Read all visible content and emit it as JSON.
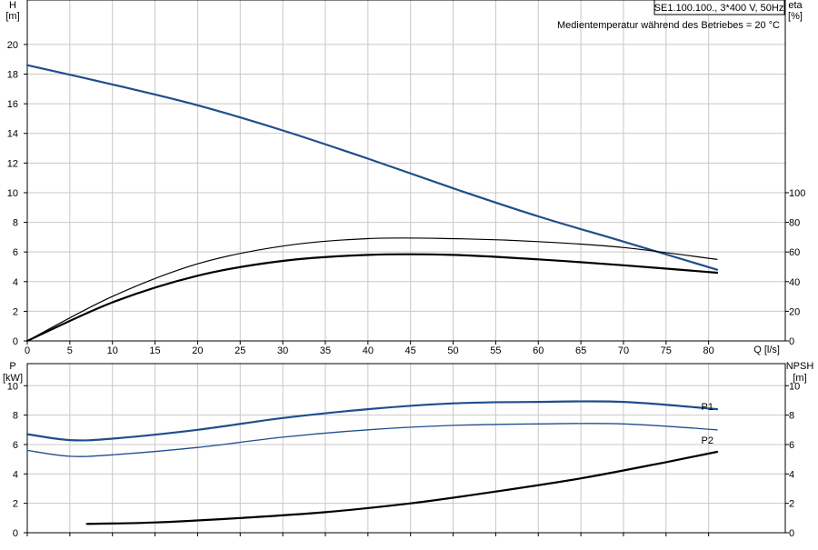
{
  "chart_data": [
    {
      "type": "line",
      "panel": "upper",
      "title": "SE1.100.100., 3*400 V, 50Hz",
      "subtitle": "Medientemperatur während des Betriebes = 20 °C",
      "left_axis": {
        "label": "H",
        "unit": "[m]",
        "ticks": [
          0,
          2,
          4,
          6,
          8,
          10,
          12,
          14,
          16,
          18,
          20
        ]
      },
      "right_axis": {
        "label": "eta",
        "unit": "[%]",
        "ticks": [
          0,
          20,
          40,
          60,
          80,
          100
        ]
      },
      "x_axis": {
        "label": "Q [l/s]",
        "ticks": [
          0,
          5,
          10,
          15,
          20,
          25,
          30,
          35,
          40,
          45,
          50,
          55,
          60,
          65,
          70,
          75,
          80
        ],
        "range": [
          0,
          89
        ]
      },
      "ylim": [
        0,
        23
      ],
      "grid": true,
      "series": [
        {
          "color": "#1f4e8c",
          "width": 2.2,
          "x": [
            0,
            10,
            20,
            30,
            40,
            50,
            60,
            70,
            81
          ],
          "y": [
            18.6,
            17.3,
            15.9,
            14.2,
            12.3,
            10.3,
            8.4,
            6.7,
            4.8
          ]
        },
        {
          "color": "#000000",
          "width": 1.2,
          "x": [
            0,
            10,
            20,
            30,
            40,
            50,
            60,
            70,
            81
          ],
          "y": [
            0,
            3.0,
            5.2,
            6.4,
            6.9,
            6.9,
            6.7,
            6.3,
            5.5
          ]
        },
        {
          "color": "#000000",
          "width": 2.2,
          "x": [
            0,
            10,
            20,
            30,
            40,
            50,
            60,
            70,
            81
          ],
          "y": [
            0,
            2.6,
            4.4,
            5.4,
            5.8,
            5.8,
            5.5,
            5.1,
            4.6
          ]
        }
      ]
    },
    {
      "type": "line",
      "panel": "lower",
      "left_axis": {
        "label": "P",
        "unit": "[kW]",
        "ticks": [
          0,
          2,
          4,
          6,
          8,
          10
        ]
      },
      "right_axis": {
        "label": "NPSH",
        "unit": "[m]",
        "ticks": [
          0,
          2,
          4,
          6,
          8,
          10
        ]
      },
      "x_axis": {
        "range": [
          0,
          89
        ],
        "ticks": [
          0,
          5,
          10,
          15,
          20,
          25,
          30,
          35,
          40,
          45,
          50,
          55,
          60,
          65,
          70,
          75,
          80
        ]
      },
      "ylim": [
        0,
        11.5
      ],
      "grid": true,
      "series": [
        {
          "name": "P1",
          "color": "#1f4e8c",
          "width": 2.2,
          "x": [
            0,
            5,
            10,
            20,
            30,
            40,
            50,
            60,
            70,
            81
          ],
          "y": [
            6.7,
            6.3,
            6.4,
            7.0,
            7.8,
            8.4,
            8.8,
            8.9,
            8.9,
            8.4
          ]
        },
        {
          "name": "P2",
          "color": "#1f4e8c",
          "width": 1.3,
          "x": [
            0,
            5,
            10,
            20,
            30,
            40,
            50,
            60,
            70,
            81
          ],
          "y": [
            5.6,
            5.2,
            5.3,
            5.8,
            6.5,
            7.0,
            7.3,
            7.4,
            7.4,
            7.0
          ]
        },
        {
          "color": "#000000",
          "width": 2.2,
          "x": [
            7,
            15,
            25,
            35,
            45,
            55,
            65,
            75,
            81
          ],
          "y": [
            0.6,
            0.7,
            1.0,
            1.4,
            2.0,
            2.8,
            3.7,
            4.8,
            5.5
          ]
        }
      ]
    }
  ]
}
